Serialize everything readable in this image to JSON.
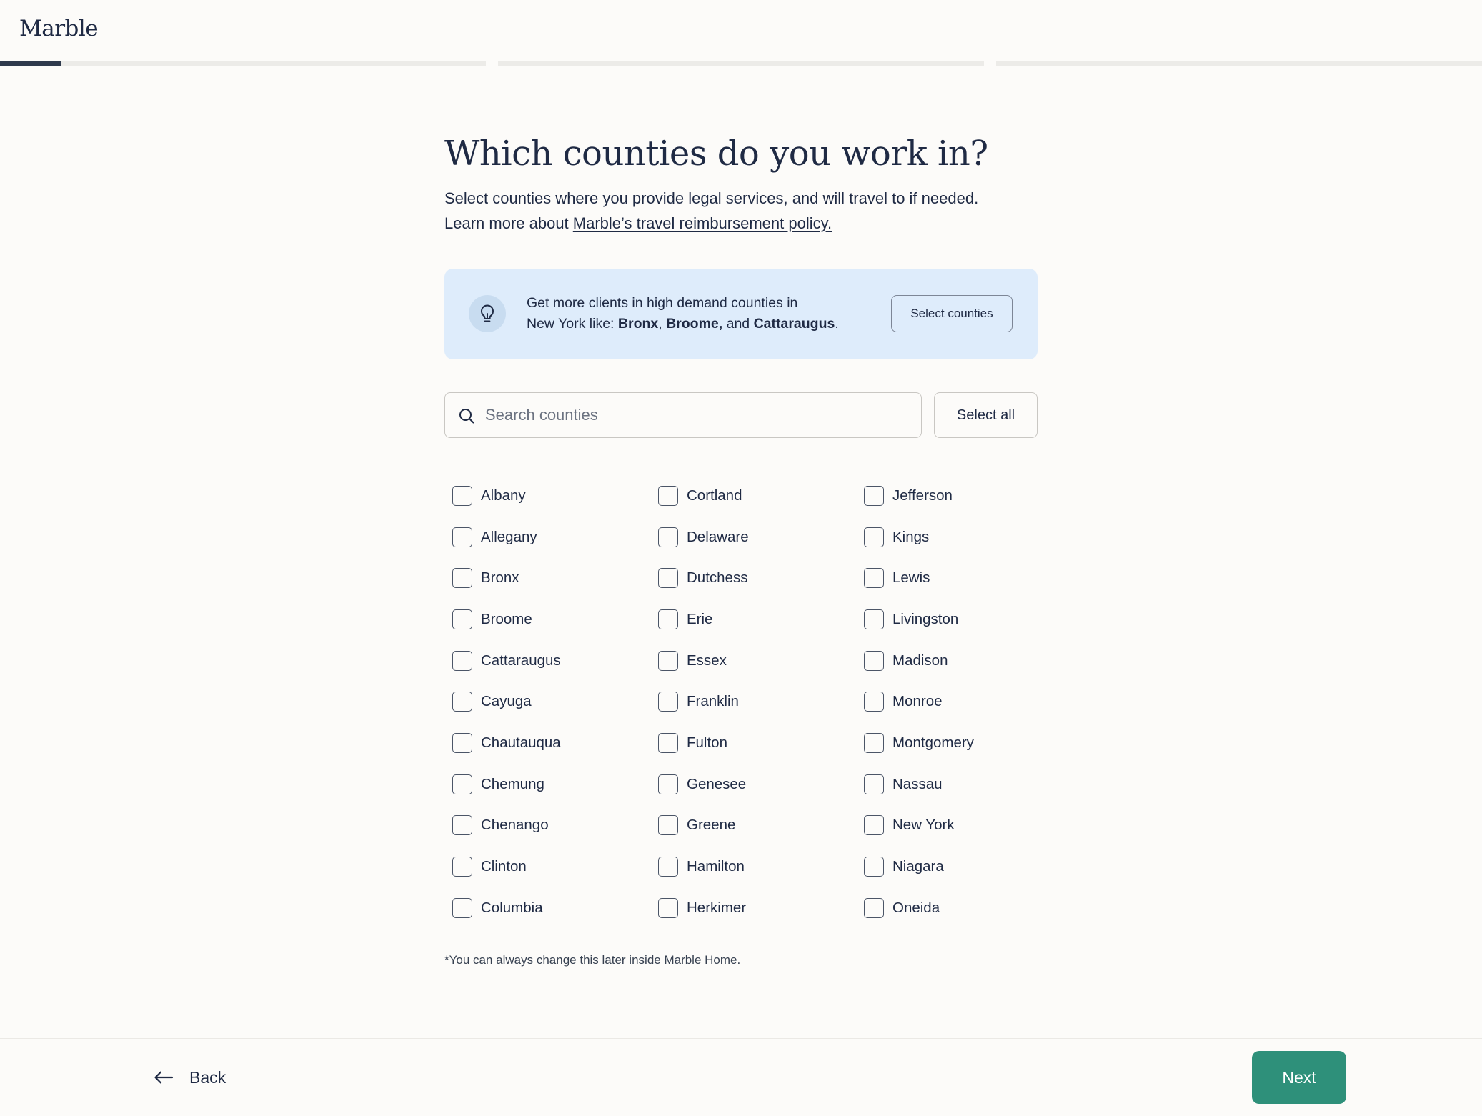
{
  "header": {
    "logo": "Marble",
    "progress": {
      "steps": 3,
      "current_step": 1,
      "current_step_fraction": 0.125
    }
  },
  "main": {
    "title": "Which counties do you work in?",
    "subtitle_line1": "Select counties where you provide legal services, and will travel to if needed.",
    "subtitle_line2_prefix": "Learn more about ",
    "subtitle_link": "Marble’s travel reimbursement policy.",
    "tip": {
      "icon": "lightbulb-icon",
      "line1": "Get more clients in high demand counties in",
      "line2_prefix": "New York like: ",
      "highlight_1": "Bronx",
      "sep_1": ", ",
      "highlight_2": "Broome,",
      "sep_2": " and ",
      "highlight_3": "Cattaraugus",
      "suffix": ".",
      "button": "Select counties"
    },
    "search": {
      "placeholder": "Search counties",
      "value": ""
    },
    "select_all": "Select all",
    "counties": [
      "Albany",
      "Allegany",
      "Bronx",
      "Broome",
      "Cattaraugus",
      "Cayuga",
      "Chautauqua",
      "Chemung",
      "Chenango",
      "Clinton",
      "Columbia",
      "Cortland",
      "Delaware",
      "Dutchess",
      "Erie",
      "Essex",
      "Franklin",
      "Fulton",
      "Genesee",
      "Greene",
      "Hamilton",
      "Herkimer",
      "Jefferson",
      "Kings",
      "Lewis",
      "Livingston",
      "Madison",
      "Monroe",
      "Montgomery",
      "Nassau",
      "New York",
      "Niagara",
      "Oneida"
    ],
    "footnote": "*You can always change this later inside Marble Home."
  },
  "footer": {
    "back": "Back",
    "next": "Next"
  },
  "colors": {
    "background": "#fcfbf9",
    "text": "#1f2a44",
    "tip_background": "#deecfb",
    "progress_fill": "#2f3a4d",
    "next_button": "#2e907a"
  }
}
